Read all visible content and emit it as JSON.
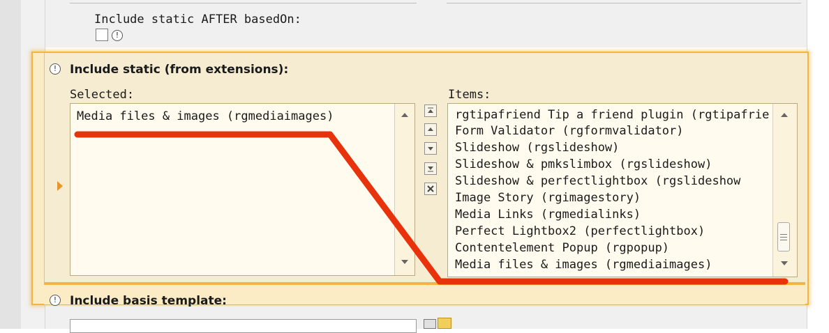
{
  "top": {
    "after_label": "Include static AFTER basedOn:",
    "after_checked": false
  },
  "section": {
    "title": "Include static (from extensions):",
    "selected_label": "Selected:",
    "items_label": "Items:",
    "selected": [
      "Media files & images (rgmediaimages)"
    ],
    "items": [
      "rgtipafriend Tip a friend plugin (rgtipafrie",
      "Form Validator (rgformvalidator)",
      "Slideshow (rgslideshow)",
      "Slideshow & pmkslimbox (rgslideshow)",
      "Slideshow & perfectlightbox (rgslideshow",
      "Image Story (rgimagestory)",
      "Media Links (rgmedialinks)",
      "Perfect Lightbox2 (perfectlightbox)",
      "Contentelement Popup (rgpopup)",
      "Media files & images (rgmediaimages)"
    ]
  },
  "basis": {
    "title": "Include basis template:"
  },
  "colors": {
    "highlight_border": "#f2b53f",
    "section_bg": "#fbecc6",
    "annotation_red": "#e8320c",
    "arrow": "#e7962b"
  },
  "icons": [
    "info-icon",
    "move-top-icon",
    "move-up-icon",
    "move-down-icon",
    "move-bottom-icon",
    "remove-icon",
    "folder-icon",
    "expand-arrow-icon"
  ]
}
